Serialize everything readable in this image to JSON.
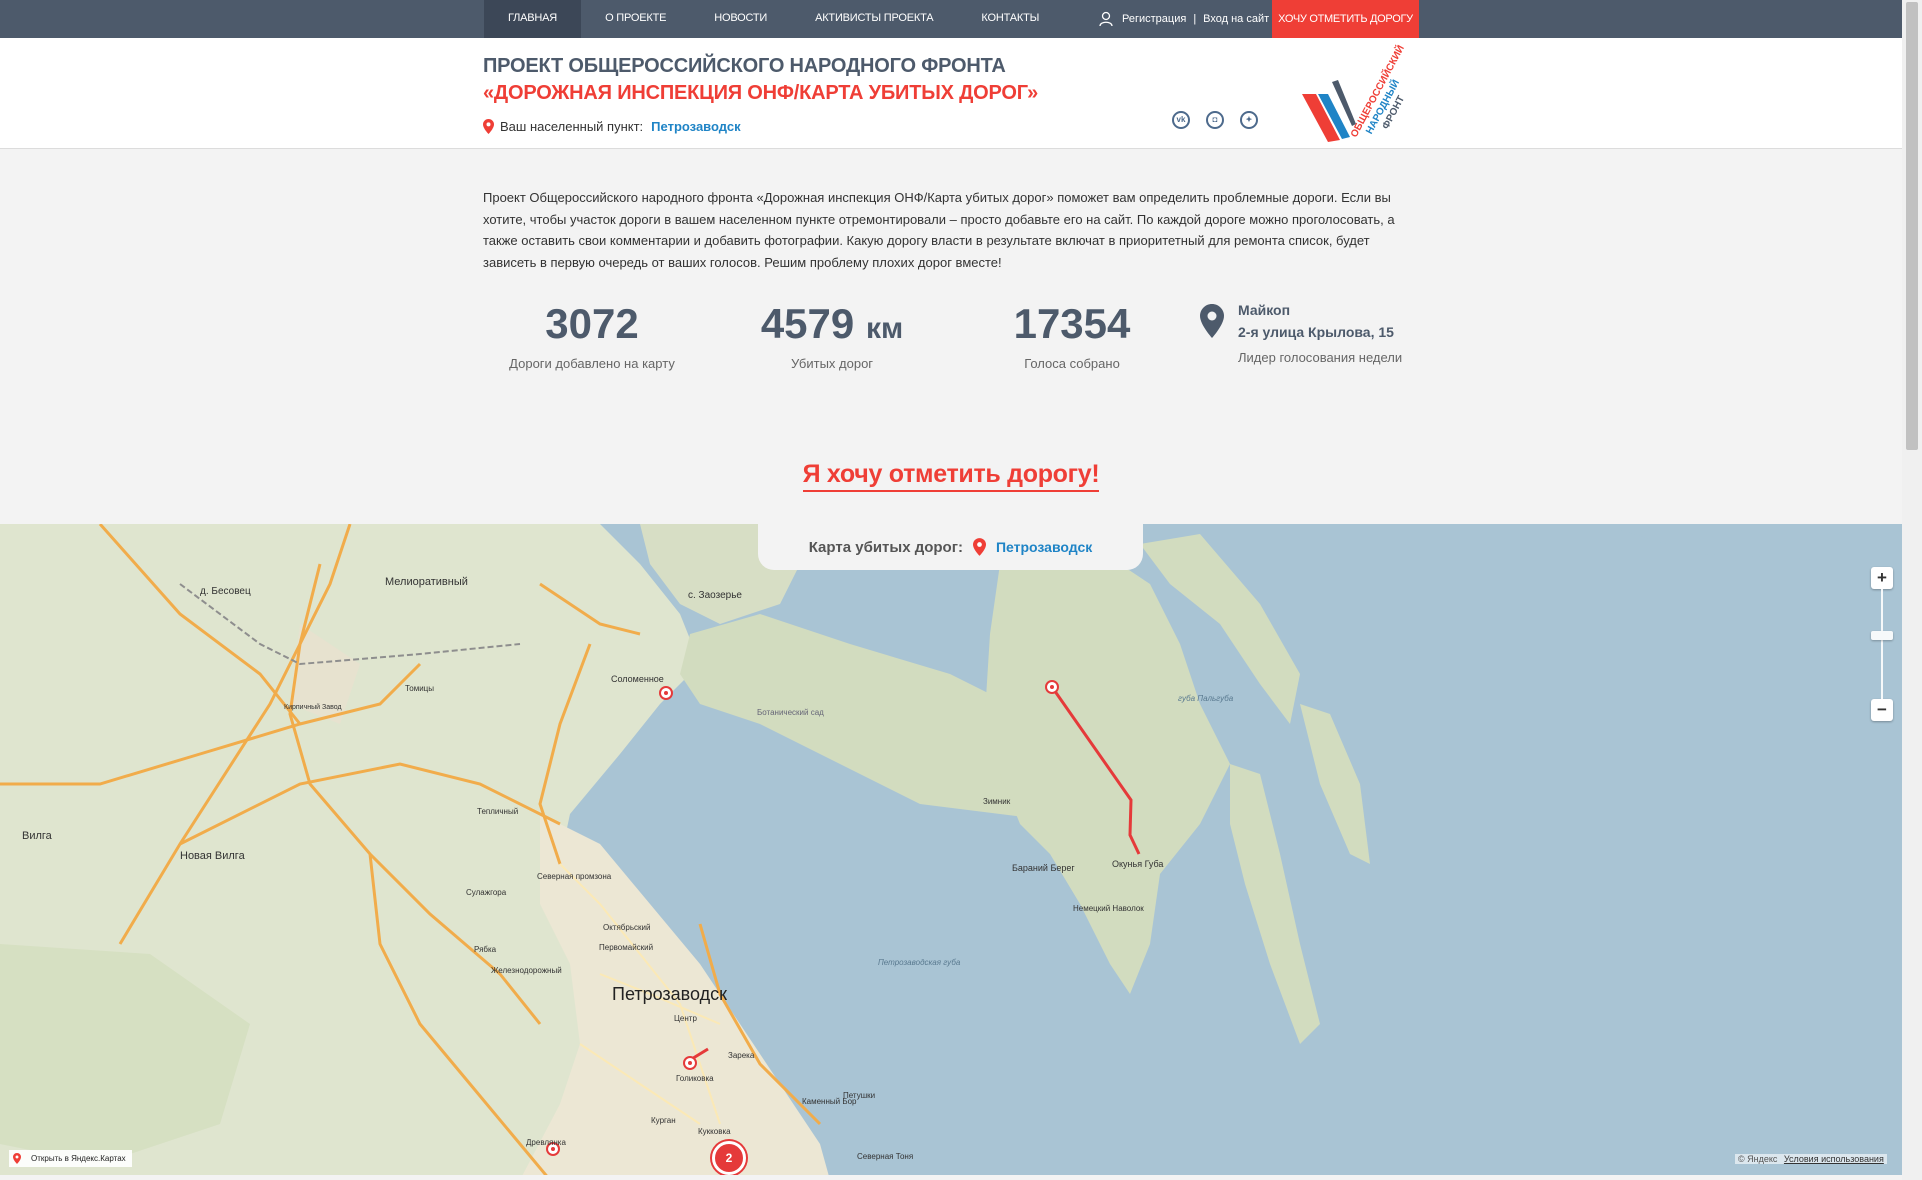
{
  "nav": {
    "items": [
      "Главная",
      "О проекте",
      "Новости",
      "Активисты проекта",
      "Контакты"
    ],
    "register": "Регистрация",
    "separator": "|",
    "login": "Вход на сайт",
    "cta": "Хочу отметить дорогу"
  },
  "header": {
    "title_line1": "Проект Общероссийского народного фронта",
    "title_line2": "«Дорожная инспекция ОНФ/Карта убитых дорог»",
    "location_label": "Ваш населенный пункт:",
    "location_city": "Петрозаводск",
    "social": [
      "vk-icon",
      "instagram-icon",
      "twitter-icon"
    ],
    "logo_text": [
      "ОБЩЕРОССИЙСКИЙ",
      "НАРОДНЫЙ",
      "ФРОНТ"
    ]
  },
  "intro": "Проект Общероссийского народного фронта «Дорожная инспекция ОНФ/Карта убитых дорог» поможет вам определить проблемные дороги. Если вы хотите, чтобы участок дороги в вашем населенном пункте отремонтировали – просто добавьте его на сайт. По каждой дороге можно проголосовать, а также оставить свои комментарии и добавить фотографии. Какую дорогу власти в результате включат в приоритетный для ремонта список, будет зависеть в первую очередь от ваших голосов. Решим проблему плохих дорог вместе!",
  "stats": {
    "roads": {
      "value": "3072",
      "label": "Дороги добавлено на карту"
    },
    "km": {
      "value": "4579",
      "unit": "км",
      "label": "Убитых дорог"
    },
    "votes": {
      "value": "17354",
      "label": "Голоса собрано"
    }
  },
  "leader": {
    "city": "Майкоп",
    "address": "2-я улица Крылова, 15",
    "label": "Лидер голосования недели"
  },
  "cta_big": "Я хочу отметить дорогу!",
  "map": {
    "tab_label": "Карта убитых дорог:",
    "tab_city": "Петрозаводск",
    "zoom_in": "+",
    "zoom_out": "−",
    "open_in_yandex": "Открыть в Яндекс.Картах",
    "copyright": "© Яндекс",
    "terms": "Условия использования",
    "cluster_count": "2",
    "labels": {
      "city": "Петрозаводск",
      "melio": "Мелиоративный",
      "besovets": "д. Бесовец",
      "zaozerie": "с. Заозерье",
      "solomennoe": "Соломенное",
      "vilga": "Вилга",
      "novaya_vilga": "Новая Вилга",
      "tomitsy": "Томицы",
      "botanicheskiy": "Ботанический сад",
      "zimnik": "Зимник",
      "barany_bereg": "Бараний Берег",
      "okunya": "Окунья Губа",
      "nemeckiy": "Немецкий Наволок",
      "petrozavodskaya_guba": "Петрозаводская губа",
      "guba_panigub": "губа Пальгуба",
      "severnaya_promzona": "Северная промзона",
      "sulazhgora": "Сулажгора",
      "oktyabrsky": "Октябрьский",
      "pervomaysky": "Первомайский",
      "ryabka": "Рябка",
      "zheleznodorozhny": "Железнодорожный",
      "tsentr": "Центр",
      "zareka": "Зарека",
      "golikovka": "Голиковка",
      "kukkovka": "Кукковка",
      "kurgan": "Курган",
      "drevlyanka": "Древлянка",
      "kamenny_bor": "Каменный Бор",
      "petushi": "Петушки",
      "teplichny": "Тепличный",
      "severnaya_tonya": "Северная Тоня",
      "kirpichny": "Кирпичный Завод"
    }
  }
}
